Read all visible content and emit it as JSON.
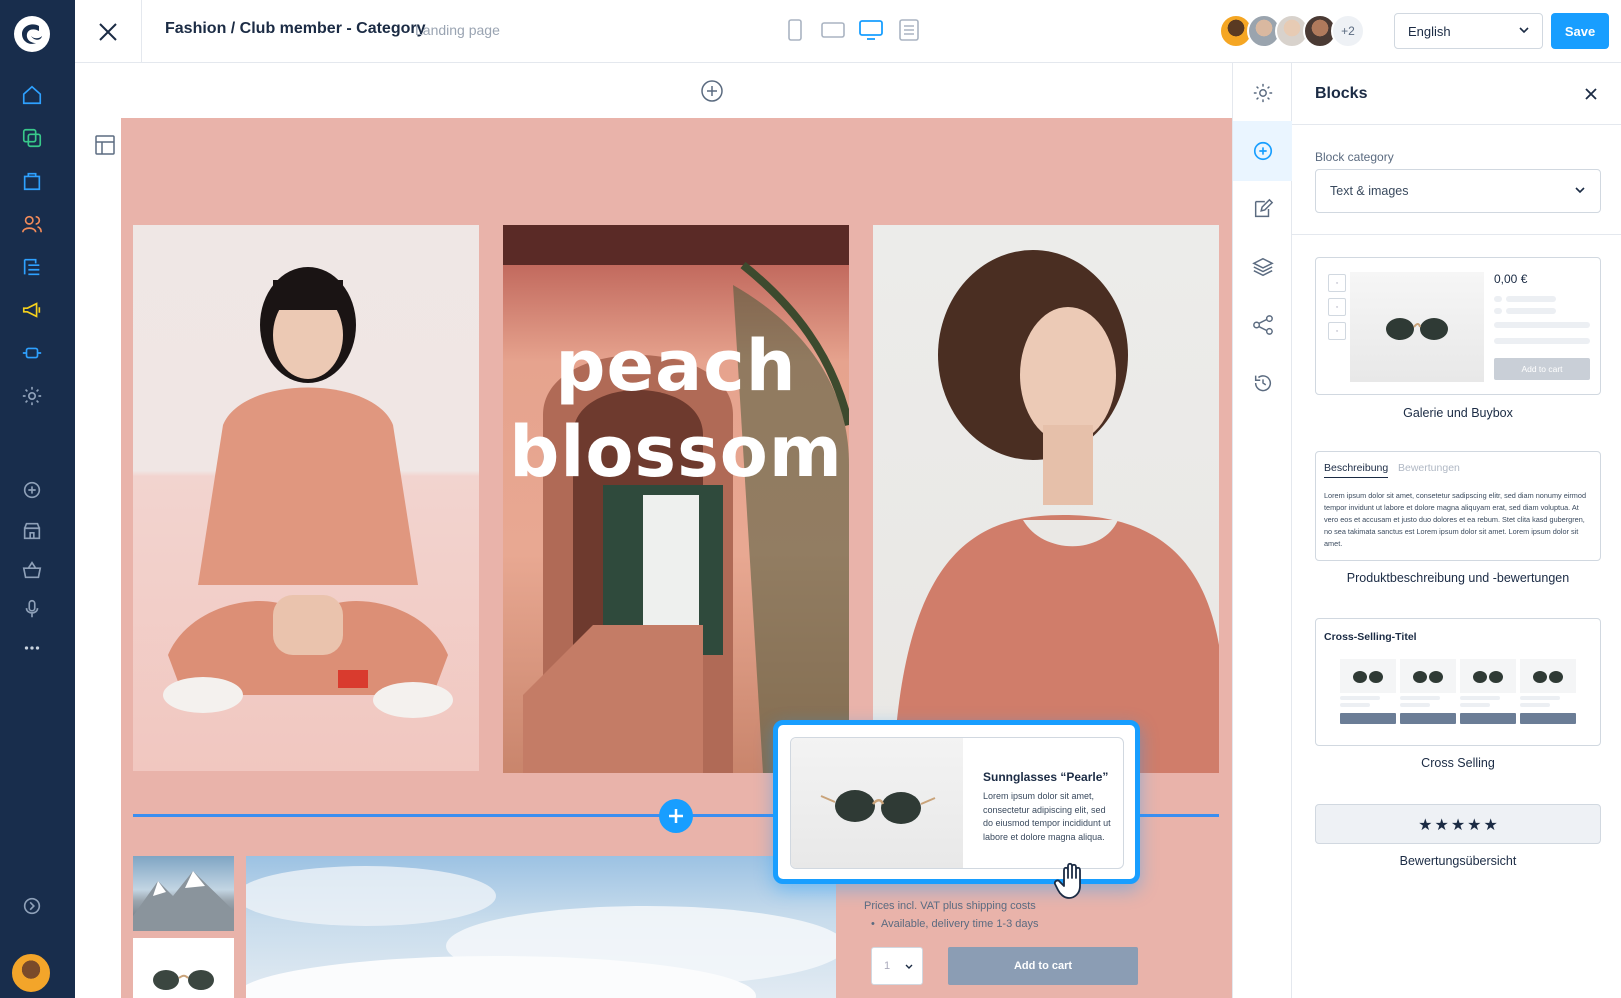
{
  "topbar": {
    "breadcrumb": "Fashion / Club member - Category",
    "page_type": "Landing page",
    "collaborators_more": "+2",
    "language": "English",
    "save_label": "Save"
  },
  "canvas": {
    "hero_line1": "peach",
    "hero_line2": "blossom",
    "price_note": "Prices incl. VAT plus shipping costs",
    "availability": "Available, delivery time 1-3 days",
    "quantity": "1",
    "add_to_cart": "Add to cart",
    "drag_card": {
      "title": "Sunnglasses “Pearle”",
      "text": "Lorem ipsum dolor sit amet, consectetur adipiscing elit, sed do eiusmod tempor incididunt ut labore et dolore magna aliqua."
    }
  },
  "panel": {
    "title": "Blocks",
    "category_label": "Block category",
    "category_value": "Text & images",
    "blocks": [
      {
        "label": "Galerie und Buybox",
        "price": "0,00 €",
        "cart": "Add to cart"
      },
      {
        "label": "Produktbeschreibung und -bewertungen",
        "tab1": "Beschreibung",
        "tab2": "Bewertungen",
        "lorem": "Lorem ipsum dolor sit amet, consetetur sadipscing elitr, sed diam nonumy eirmod tempor invidunt ut labore et dolore magna aliquyam erat, sed diam voluptua. At vero eos et accusam et justo duo dolores et ea rebum. Stet clita kasd gubergren, no sea takimata sanctus est Lorem ipsum dolor sit amet. Lorem ipsum dolor sit amet."
      },
      {
        "label": "Cross Selling",
        "title": "Cross-Selling-Titel"
      },
      {
        "label": "Bewertungsübersicht",
        "stars": "★★★★★"
      }
    ]
  },
  "colors": {
    "nav_bg": "#182d4c",
    "accent": "#189eff",
    "stage_bg": "#e9b3aa"
  }
}
